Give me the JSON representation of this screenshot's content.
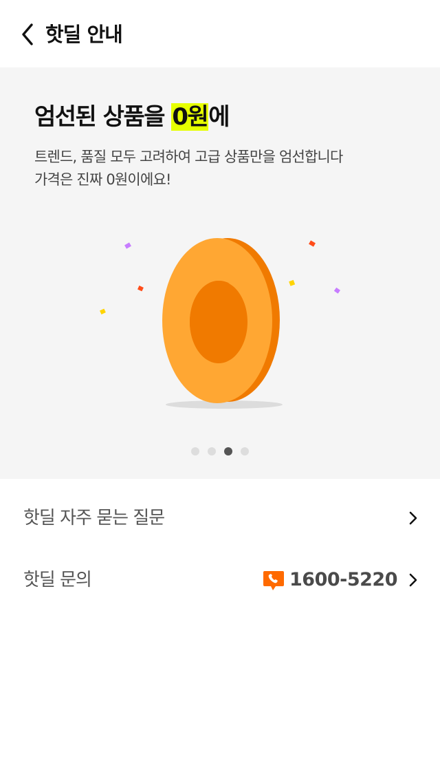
{
  "header": {
    "title": "핫딜 안내"
  },
  "banner": {
    "title_prefix": "엄선된 상품을 ",
    "title_highlight": "0원",
    "title_suffix": "에",
    "desc_line1": "트렌드, 품질 모두 고려하여 고급 상품만을 엄선합니다",
    "desc_line2": "가격은 진짜 0원이에요!",
    "highlight_color": "#e6ff00",
    "background_color": "#f5f5f5",
    "illustration": "big-orange-zero-with-confetti",
    "pagination": {
      "total": 4,
      "current": 3
    }
  },
  "menu": {
    "faq_label": "핫딜 자주 묻는 질문",
    "contact_label": "핫딜 문의",
    "contact_phone": "1600-5220",
    "contact_icon": "phone-chat-bubble-icon",
    "accent_color": "#ff6a00"
  }
}
